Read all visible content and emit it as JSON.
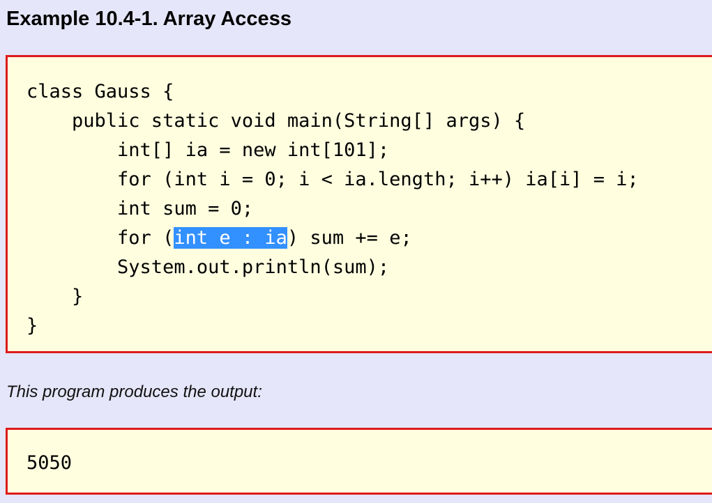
{
  "example": {
    "title": "Example 10.4-1. Array Access"
  },
  "code": {
    "lines": [
      "class Gauss {",
      "    public static void main(String[] args) {",
      "        int[] ia = new int[101];",
      "        for (int i = 0; i < ia.length; i++) ia[i] = i;",
      "        int sum = 0;",
      "        for (int e : ia) sum += e;",
      "        System.out.println(sum);",
      "    }",
      "}"
    ],
    "selected_line": {
      "before": "        for (",
      "selected": "int e : ia",
      "after": ") sum += e;"
    },
    "selection_color": "#3390ff"
  },
  "caption": "This program produces the output:",
  "output": "5050",
  "colors": {
    "page_background": "#e6e6fa",
    "box_background": "#ffffe0",
    "box_border": "#dd1a1a"
  }
}
